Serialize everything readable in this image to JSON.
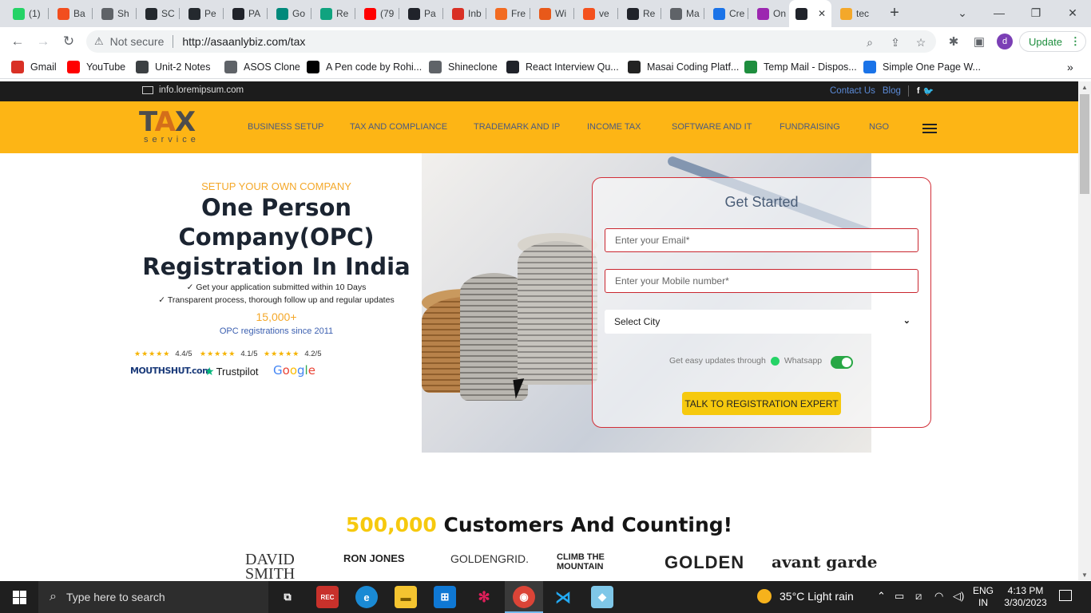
{
  "tabs": [
    {
      "label": "(1)",
      "icon": "whatsapp-icon",
      "color": "#25d366"
    },
    {
      "label": "Ba",
      "icon": "figma-icon",
      "color": "#f24e1e"
    },
    {
      "label": "Sh",
      "icon": "globe-icon",
      "color": "#5f6368"
    },
    {
      "label": "SC",
      "icon": "github-icon",
      "color": "#24292e"
    },
    {
      "label": "Pe",
      "icon": "github-icon",
      "color": "#24292e"
    },
    {
      "label": "PA",
      "icon": "react-icon",
      "color": "#20232a"
    },
    {
      "label": "Go",
      "icon": "google-meet-icon",
      "color": "#00897b"
    },
    {
      "label": "Re",
      "icon": "chatgpt-icon",
      "color": "#10a37f"
    },
    {
      "label": "(79",
      "icon": "youtube-icon",
      "color": "#ff0000"
    },
    {
      "label": "Pa",
      "icon": "react-icon",
      "color": "#20232a"
    },
    {
      "label": "Inb",
      "icon": "gmail-icon",
      "color": "#d93025"
    },
    {
      "label": "Fre",
      "icon": "box-icon",
      "color": "#f26b21"
    },
    {
      "label": "Wi",
      "icon": "w3-icon",
      "color": "#e8591a"
    },
    {
      "label": "ve",
      "icon": "vercel-icon",
      "color": "#f4511e"
    },
    {
      "label": "Re",
      "icon": "react-icon",
      "color": "#20232a"
    },
    {
      "label": "Ma",
      "icon": "globe-icon",
      "color": "#5f6368"
    },
    {
      "label": "Cre",
      "icon": "canva-icon",
      "color": "#1a73e8"
    },
    {
      "label": "On",
      "icon": "on-icon",
      "color": "#9c27b0"
    },
    {
      "label": "",
      "icon": "react-icon",
      "color": "#20232a",
      "active": true
    },
    {
      "label": "tec",
      "icon": "tax-service-icon",
      "color": "#f4a82a"
    }
  ],
  "toolbar": {
    "security": "Not secure",
    "url": "http://asaanlybiz.com/tax",
    "profile_initial": "d",
    "update_label": "Update"
  },
  "bookmarks": [
    {
      "label": "Gmail",
      "icon": "gmail-icon",
      "color": "#d93025"
    },
    {
      "label": "YouTube",
      "icon": "youtube-icon",
      "color": "#ff0000"
    },
    {
      "label": "Unit-2 Notes",
      "icon": "pencil-icon",
      "color": "#3c4043"
    },
    {
      "label": "ASOS Clone",
      "icon": "globe-icon",
      "color": "#5f6368"
    },
    {
      "label": "A Pen code by Rohi...",
      "icon": "codepen-icon",
      "color": "#000000"
    },
    {
      "label": "Shineclone",
      "icon": "globe-icon",
      "color": "#5f6368"
    },
    {
      "label": "React Interview Qu...",
      "icon": "react-icon",
      "color": "#20232a"
    },
    {
      "label": "Masai Coding Platf...",
      "icon": "masai-icon",
      "color": "#222222"
    },
    {
      "label": "Temp Mail - Dispos...",
      "icon": "tempmail-icon",
      "color": "#1e8e3e"
    },
    {
      "label": "Simple One Page W...",
      "icon": "bookmark-icon",
      "color": "#1a73e8"
    }
  ],
  "site": {
    "email": "info.loremipsum.com",
    "contact": "Contact Us",
    "blog": "Blog",
    "logo_main": "TAX",
    "logo_sub": "service",
    "nav": [
      "BUSINESS SETUP",
      "TAX AND COMPLIANCE",
      "TRADEMARK AND IP",
      "INCOME TAX",
      "SOFTWARE AND IT",
      "FUNDRAISING",
      "NGO"
    ]
  },
  "hero": {
    "kicker": "SETUP YOUR OWN COMPANY",
    "title": "One Person Company(OPC) Registration In India",
    "bullet1": "✓ Get your application submitted within 10 Days",
    "bullet2": "✓ Transparent process, thorough follow up and regular updates",
    "count": "15,000+",
    "count_sub": "OPC registrations since 2011",
    "ratings": [
      {
        "source": "MouthShut",
        "value": "4.4/5",
        "stars": 4.5
      },
      {
        "source": "Trustpilot",
        "value": "4.1/5",
        "stars": 4
      },
      {
        "source": "Google",
        "value": "4.2/5",
        "stars": 4
      }
    ],
    "brands": {
      "mouthshut": "MOUTHSHUT.com",
      "trustpilot": "Trustpilot",
      "google": "Google"
    }
  },
  "form": {
    "title": "Get Started",
    "email_placeholder": "Enter your Email*",
    "mobile_placeholder": "Enter your Mobile number*",
    "city_selected": "Select City",
    "whatsapp_text": "Get easy updates through",
    "whatsapp_label": "Whatsapp",
    "whatsapp_on": true,
    "cta": "TALK TO REGISTRATION EXPERT"
  },
  "customers": {
    "count": "500,000",
    "text": "Customers And Counting!",
    "logos": [
      "DAVID SMITH",
      "RON JONES",
      "GOLDENGRID.",
      "CLIMB THE MOUNTAIN",
      "GOLDEN",
      "avant garde"
    ]
  },
  "taskbar": {
    "search_placeholder": "Type here to search",
    "weather": "35°C  Light rain",
    "lang1": "ENG",
    "lang2": "IN",
    "time": "4:13 PM",
    "date": "3/30/2023"
  }
}
